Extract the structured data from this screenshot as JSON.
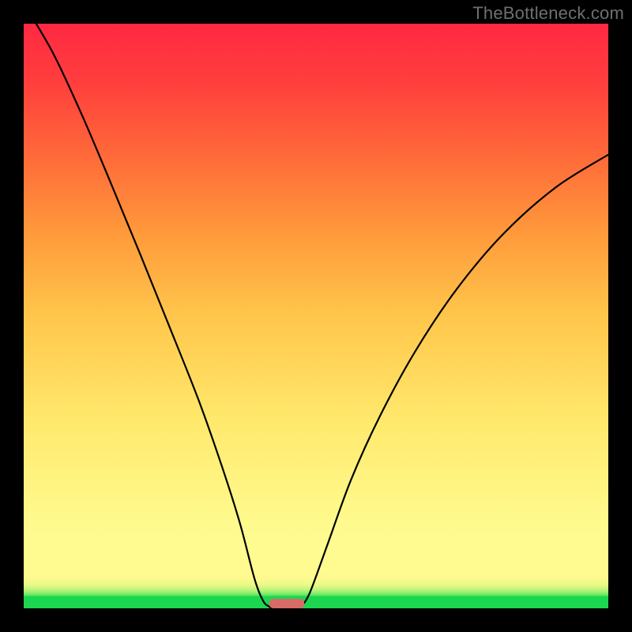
{
  "watermark": "TheBottleneck.com",
  "chart_data": {
    "type": "line",
    "title": "",
    "xlabel": "",
    "ylabel": "",
    "xlim": [
      0,
      1
    ],
    "ylim": [
      0,
      1
    ],
    "x": [
      0.0,
      0.05,
      0.1,
      0.15,
      0.2,
      0.25,
      0.3,
      0.34,
      0.37,
      0.395,
      0.41,
      0.42,
      0.425,
      0.445,
      0.47,
      0.475,
      0.49,
      0.52,
      0.56,
      0.61,
      0.67,
      0.74,
      0.82,
      0.91,
      1.0
    ],
    "values": [
      1.035,
      0.95,
      0.843,
      0.725,
      0.604,
      0.48,
      0.354,
      0.24,
      0.145,
      0.05,
      0.012,
      0.003,
      0.0,
      0.0,
      0.0,
      0.003,
      0.028,
      0.11,
      0.22,
      0.33,
      0.44,
      0.545,
      0.64,
      0.72,
      0.776
    ],
    "marker_range_x": [
      0.42,
      0.48
    ],
    "marker_y": 0.0,
    "gradient_stops": [
      {
        "pos": 0.0,
        "color": "#1bd64e"
      },
      {
        "pos": 0.02,
        "color": "#1bd64e"
      },
      {
        "pos": 0.05,
        "color": "#fdf98e"
      },
      {
        "pos": 0.12,
        "color": "#fffb90"
      },
      {
        "pos": 0.5,
        "color": "#ffc64b"
      },
      {
        "pos": 0.77,
        "color": "#ff6b39"
      },
      {
        "pos": 1.0,
        "color": "#ff2942"
      }
    ]
  }
}
